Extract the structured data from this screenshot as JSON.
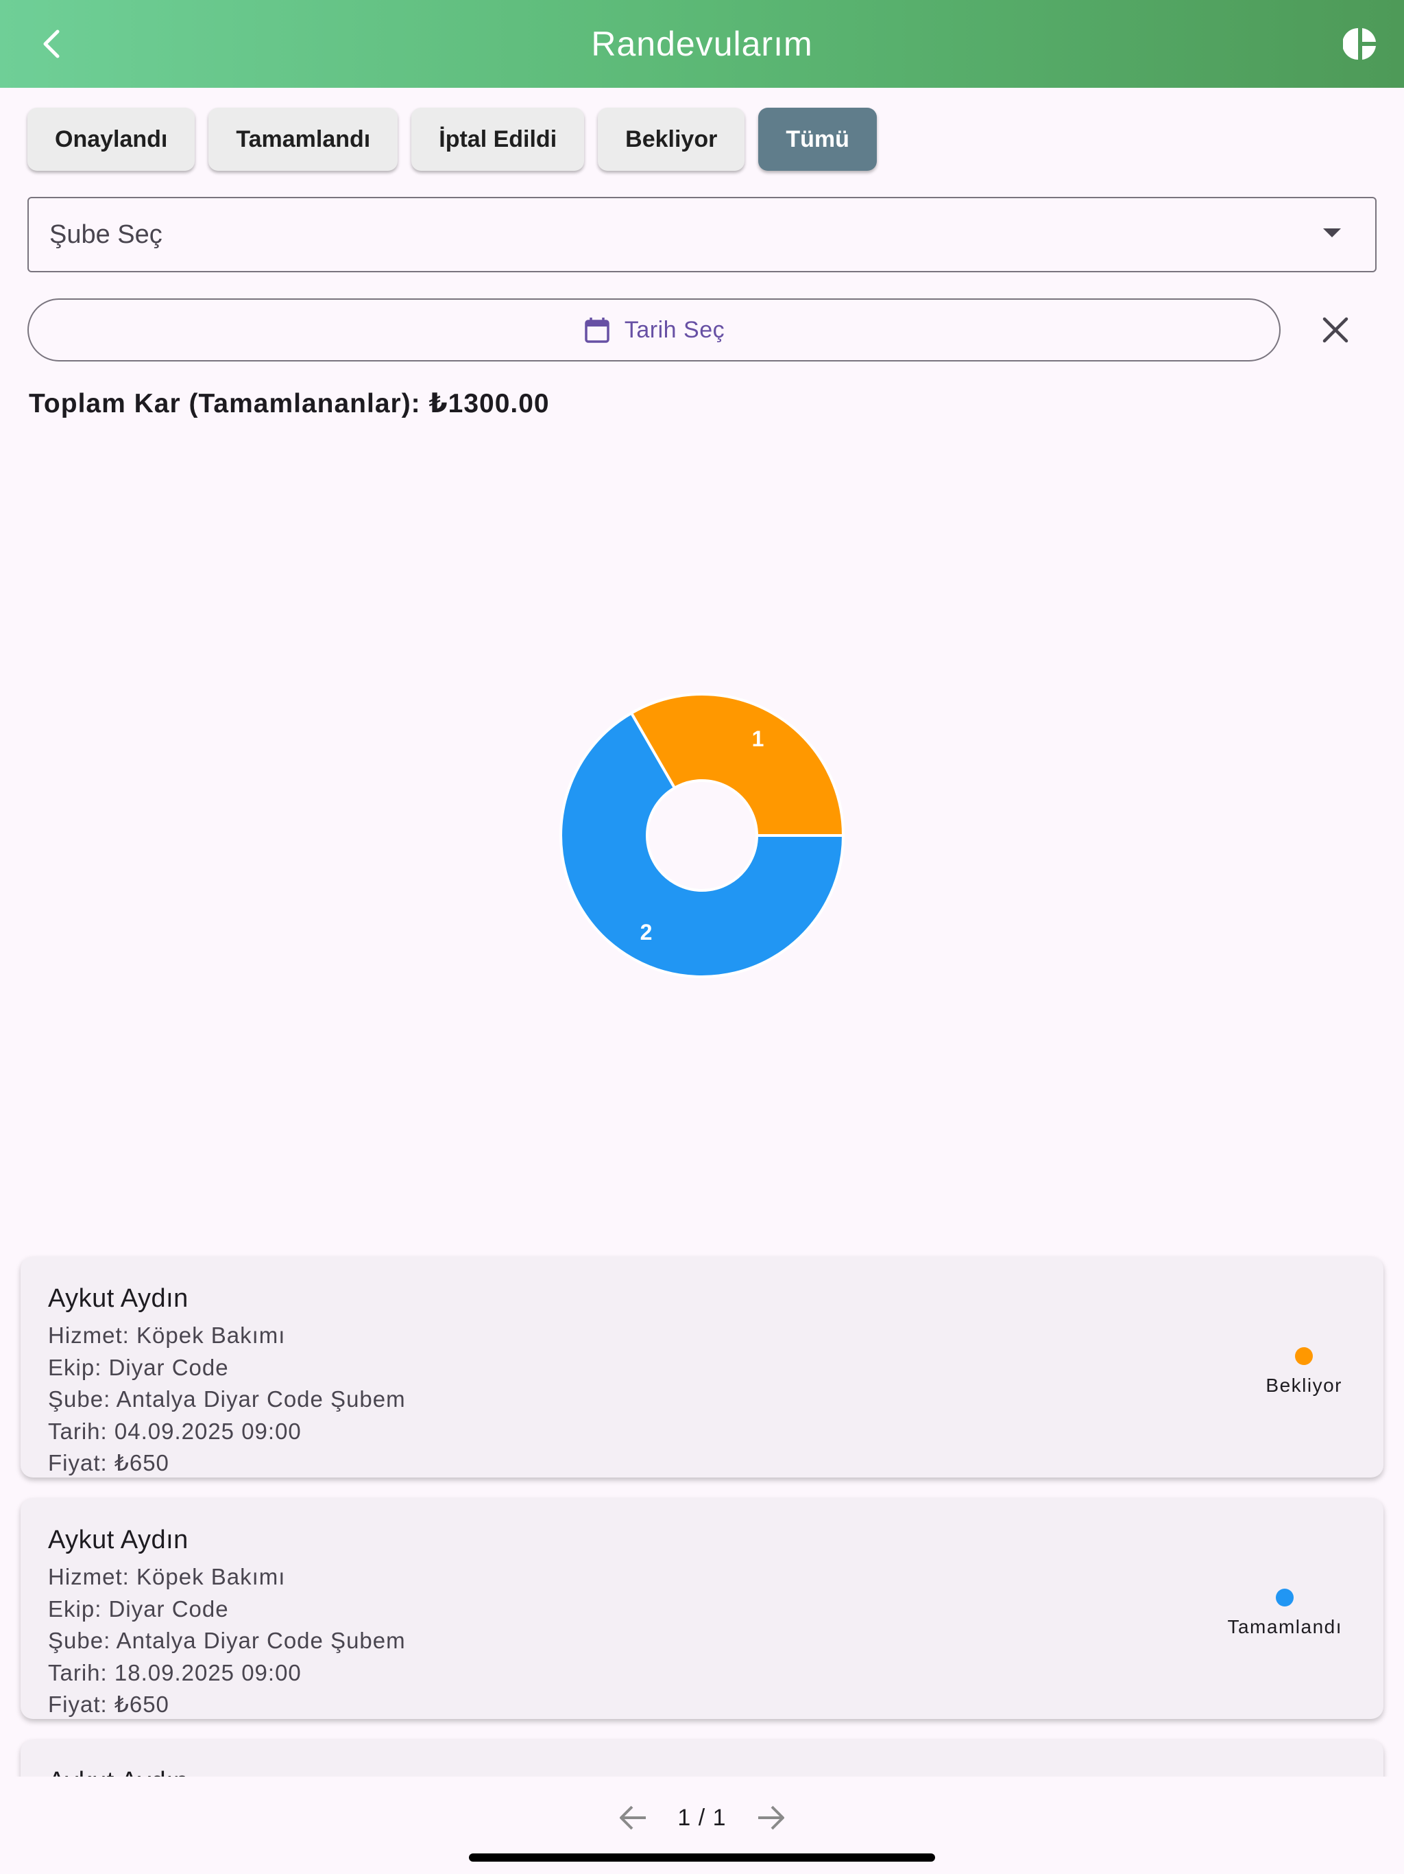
{
  "appbar": {
    "title": "Randevularım",
    "back_icon": "back-chevron-icon",
    "chart_icon": "pie-chart-icon"
  },
  "filters": [
    {
      "label": "Onaylandı",
      "active": false
    },
    {
      "label": "Tamamlandı",
      "active": false
    },
    {
      "label": "İptal Edildi",
      "active": false
    },
    {
      "label": "Bekliyor",
      "active": false
    },
    {
      "label": "Tümü",
      "active": true
    }
  ],
  "branch_select": {
    "value": "Şube Seç"
  },
  "date_picker": {
    "label": "Tarih Seç",
    "icon": "calendar-icon",
    "clear_icon": "close-icon"
  },
  "total_profit": "Toplam Kar (Tamamlananlar): ₺1300.00",
  "chart_data": {
    "type": "pie",
    "donut": true,
    "slices": [
      {
        "label": "1",
        "value": 1,
        "color": "#ff9800"
      },
      {
        "label": "2",
        "value": 2,
        "color": "#2196f3"
      }
    ]
  },
  "appointments": [
    {
      "name": "Aykut Aydın",
      "service": "Hizmet: Köpek Bakımı",
      "team": "Ekip: Diyar Code",
      "branch": "Şube: Antalya Diyar Code Şubem",
      "date": "Tarih: 04.09.2025 09:00",
      "price": "Fiyat: ₺650",
      "status": "Bekliyor",
      "status_color": "#ff9800"
    },
    {
      "name": "Aykut Aydın",
      "service": "Hizmet: Köpek Bakımı",
      "team": "Ekip: Diyar Code",
      "branch": "Şube: Antalya Diyar Code Şubem",
      "date": "Tarih: 18.09.2025 09:00",
      "price": "Fiyat: ₺650",
      "status": "Tamamlandı",
      "status_color": "#2196f3"
    },
    {
      "name": "Aykut Aydın"
    }
  ],
  "pagination": {
    "text": "1 / 1",
    "prev_icon": "arrow-left-icon",
    "next_icon": "arrow-right-icon"
  }
}
